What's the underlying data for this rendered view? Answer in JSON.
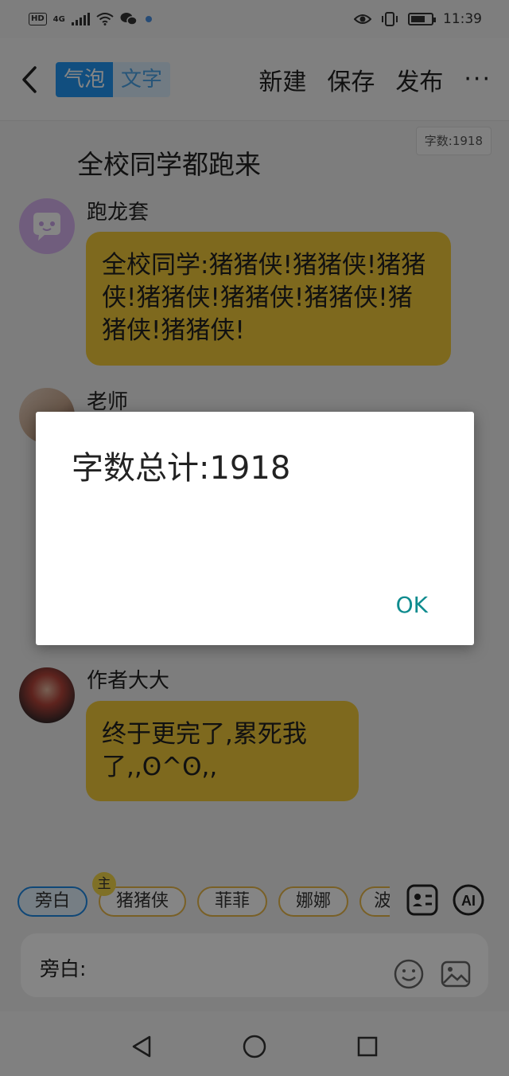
{
  "status_bar": {
    "network": "4G",
    "time": "11:39"
  },
  "top_bar": {
    "tab_bubble": "气泡",
    "tab_text": "文字",
    "new_label": "新建",
    "save_label": "保存",
    "publish_label": "发布",
    "more_label": "···"
  },
  "story": {
    "word_count_chip": "字数:1918",
    "title": "全校同学都跑来"
  },
  "messages": [
    {
      "name": "跑龙套",
      "text": "全校同学:猪猪侠!猪猪侠!猪猪侠!猪猪侠!猪猪侠!猪猪侠!猪猪侠!猪猪侠!"
    },
    {
      "name": "老师"
    },
    {
      "name": "作者大大",
      "text": "终于更完了,累死我了,,ʘ^ʘ,,"
    }
  ],
  "dialog": {
    "message": "字数总计:1918",
    "ok_label": "OK"
  },
  "roles": {
    "items": [
      "旁白",
      "猪猪侠",
      "菲菲",
      "娜娜",
      "波"
    ],
    "main_badge": "主",
    "selected_index": 0
  },
  "input": {
    "label": "旁白:"
  },
  "colors": {
    "accent": "#2196f3",
    "bubble": "#f1c93b",
    "dialog_button": "#0e8b8e"
  }
}
